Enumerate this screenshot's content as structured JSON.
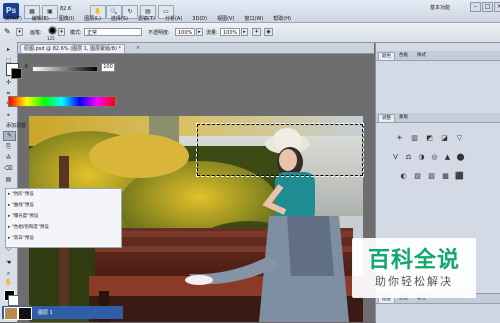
{
  "menubar": {
    "app_logo": "Ps",
    "zoom": "82.6",
    "menus": [
      "文件(F)",
      "编辑(E)",
      "图像(I)",
      "图层(L)",
      "选择(S)",
      "滤镜(T)",
      "分析(A)",
      "3D(D)",
      "视图(V)",
      "窗口(W)",
      "帮助(H)"
    ],
    "workspace": "基本功能",
    "window_controls": [
      "–",
      "□",
      "×"
    ]
  },
  "options_bar": {
    "brush_label": "画笔:",
    "brush_size": "125",
    "mode_label": "模式:",
    "mode_value": "正常",
    "opacity_label": "不透明度:",
    "opacity_value": "100%",
    "flow_label": "流量:",
    "flow_value": "100%"
  },
  "document": {
    "tab_label": "原图.psd @ 82.6% (图层 1, 图层蒙版/8) *",
    "close": "×"
  },
  "tools": [
    "▸",
    "⬚",
    "ℓ",
    "✢",
    "⌗",
    "✎",
    "⌖",
    "✎",
    "⎘",
    "✇",
    "⌫",
    "▤",
    "◐",
    "◉",
    "✒",
    "T",
    "▸",
    "◇",
    "☚",
    "⌕",
    "✋",
    "🔍"
  ],
  "panels": {
    "color_tabs": [
      "颜色",
      "色板",
      "样式"
    ],
    "k_label": "K",
    "k_value": "100",
    "adjust_tabs": [
      "调整",
      "蒙版"
    ],
    "adjust_title": "添加调整",
    "adjust_icons_row1": [
      "☀",
      "▥",
      "◩",
      "◪",
      "▽"
    ],
    "adjust_icons_row2": [
      "V",
      "⚖",
      "◑",
      "◎",
      "▲",
      "⬤"
    ],
    "adjust_icons_row3": [
      "◐",
      "▧",
      "▨",
      "▩",
      "⬛"
    ],
    "presets": [
      "\"色阶\"预设",
      "\"曲线\"预设",
      "\"曝光度\"预设",
      "\"色相/饱和度\"预设",
      "\"黑白\"预设"
    ],
    "layers_tabs": [
      "图层",
      "通道",
      "路径"
    ],
    "layer_name": "图层 1"
  },
  "watermark": {
    "title": "百科全说",
    "subtitle": "助你轻松解决"
  }
}
